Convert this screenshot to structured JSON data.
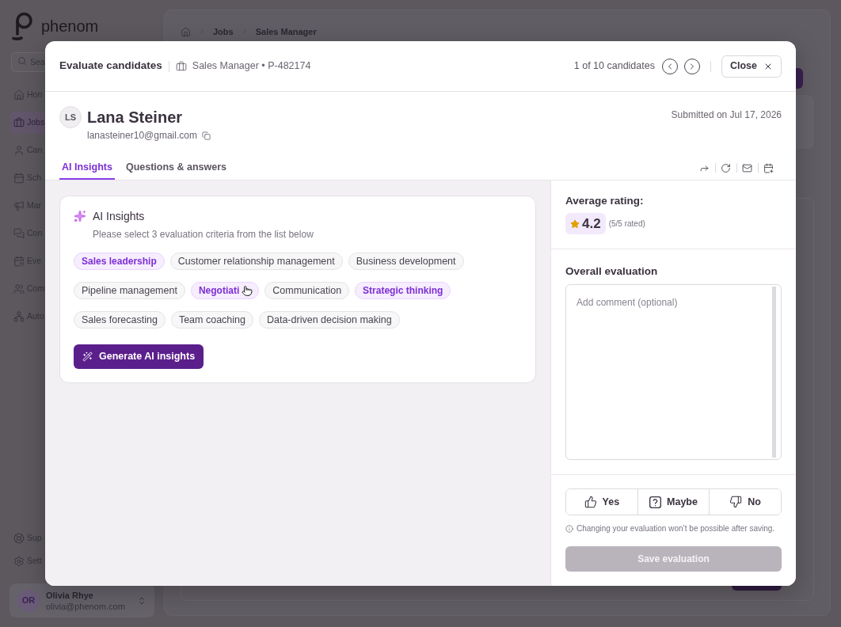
{
  "background": {
    "logo": "phenom",
    "search": {
      "placeholder": "Sea"
    },
    "nav_items": [
      {
        "label": "Hon",
        "selected": false
      },
      {
        "label": "Jobs",
        "selected": true
      },
      {
        "label": "Can",
        "selected": false
      },
      {
        "label": "Sch",
        "selected": false
      },
      {
        "label": "Mar",
        "selected": false
      },
      {
        "label": "Con",
        "selected": false
      },
      {
        "label": "Eve",
        "selected": false
      },
      {
        "label": "Com",
        "selected": false
      },
      {
        "label": "Auto",
        "selected": false
      }
    ],
    "footer_items": [
      {
        "label": "Sup"
      },
      {
        "label": "Sett"
      }
    ],
    "user": {
      "initials": "OR",
      "name": "Olivia Rhye",
      "email": "olivia@phenom.com"
    },
    "breadcrumb": [
      "Jobs",
      "Sales Manager"
    ]
  },
  "modal": {
    "title": "Evaluate candidates",
    "job": "Sales Manager • P-482174",
    "pager": "1 of 10 candidates",
    "close_label": "Close",
    "candidate": {
      "initials": "LS",
      "name": "Lana Steiner",
      "email": "lanasteiner10@gmail.com",
      "submitted": "Submitted on Jul 17, 2026"
    },
    "tabs": [
      {
        "label": "AI Insights",
        "selected": true
      },
      {
        "label": "Questions & answers",
        "selected": false
      }
    ],
    "insights": {
      "title": "AI Insights",
      "subtitle": "Please select 3 evaluation criteria from the list below",
      "criteria": [
        {
          "label": "Sales leadership",
          "selected": true,
          "hovered": false
        },
        {
          "label": "Customer relationship management",
          "selected": false,
          "hovered": false
        },
        {
          "label": "Business development",
          "selected": false,
          "hovered": false
        },
        {
          "label": "Pipeline management",
          "selected": false,
          "hovered": false
        },
        {
          "label": "Negotiati",
          "selected": true,
          "hovered": true
        },
        {
          "label": "Communication",
          "selected": false,
          "hovered": false
        },
        {
          "label": "Strategic thinking",
          "selected": true,
          "hovered": false
        },
        {
          "label": "Sales forecasting",
          "selected": false,
          "hovered": false
        },
        {
          "label": "Team coaching",
          "selected": false,
          "hovered": false
        },
        {
          "label": "Data-driven decision making",
          "selected": false,
          "hovered": false
        }
      ],
      "button": "Generate AI insights"
    },
    "rating": {
      "label": "Average rating:",
      "value": "4.2",
      "count": "(5/5 rated)"
    },
    "evaluation": {
      "label": "Overall evaluation",
      "placeholder": "Add comment (optional)",
      "options": [
        {
          "kind": "yes",
          "label": "Yes",
          "selected": false
        },
        {
          "kind": "maybe",
          "label": "Maybe",
          "selected": false
        },
        {
          "kind": "no",
          "label": "No",
          "selected": false
        }
      ],
      "note": "Changing your evaluation won’t be possible after saving.",
      "save": {
        "label": "Save evaluation",
        "disabled": true
      }
    }
  }
}
